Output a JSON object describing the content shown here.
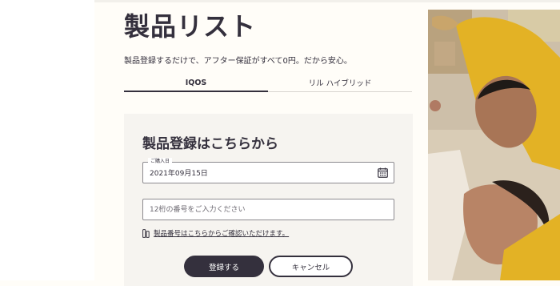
{
  "page": {
    "title": "製品リスト",
    "subtitle": "製品登録するだけで、アフター保証がすべて0円。だから安心。"
  },
  "tabs": [
    {
      "label": "IQOS",
      "active": true
    },
    {
      "label": "リル ハイブリッド",
      "active": false
    }
  ],
  "form": {
    "title": "製品登録はこちらから",
    "purchase_date": {
      "label": "ご購入日",
      "value": "2021年09月15日",
      "icon": "calendar-icon"
    },
    "serial": {
      "placeholder": "12桁の番号をご入力ください"
    },
    "hint_link": "製品番号はこちらからご確認いただけます。",
    "hint_icon": "device-icon",
    "register_label": "登録する",
    "cancel_label": "キャンセル"
  },
  "colors": {
    "primary": "#34303d",
    "background": "#fffdf8",
    "card": "#f6f4f0",
    "accent_yellow": "#e3b225"
  }
}
